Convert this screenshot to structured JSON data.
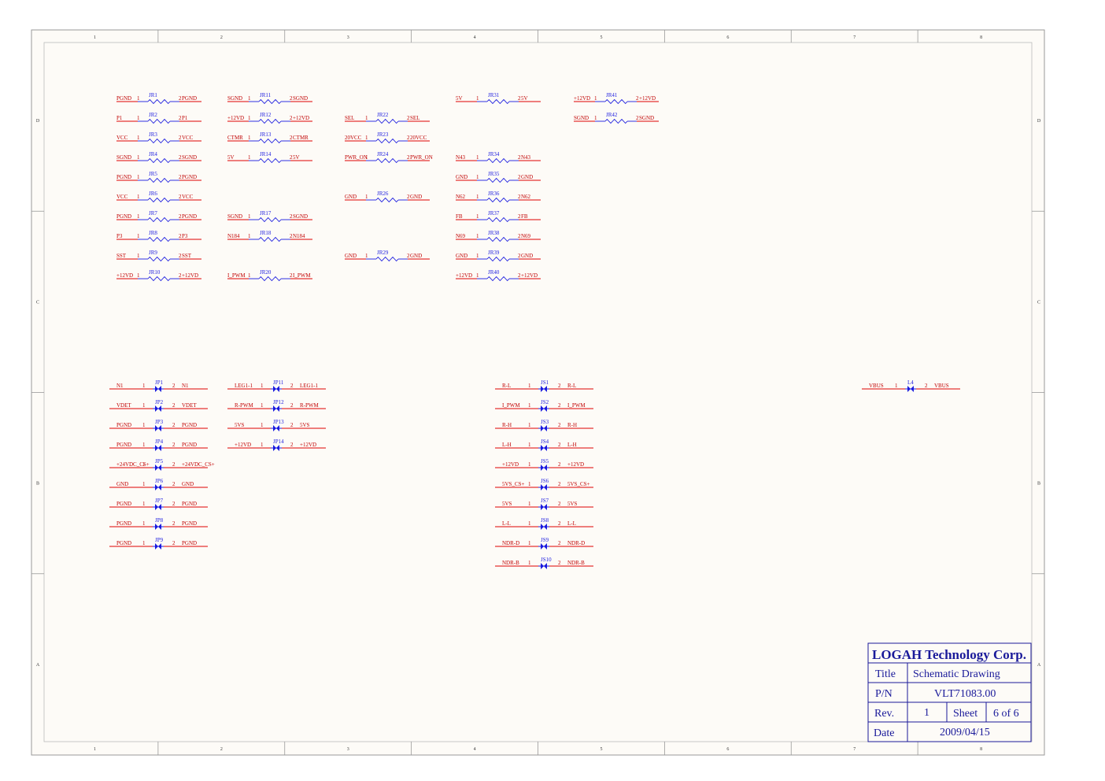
{
  "frame": {
    "columns": [
      "1",
      "2",
      "3",
      "4",
      "5",
      "6",
      "7",
      "8"
    ],
    "rows": [
      "D",
      "C",
      "B",
      "A"
    ]
  },
  "resistors": [
    {
      "ref": "JR1",
      "left": "PGND",
      "right": "PGND",
      "p1": "1",
      "p2": "2"
    },
    {
      "ref": "JR2",
      "left": "P1",
      "right": "P1",
      "p1": "1",
      "p2": "2"
    },
    {
      "ref": "JR3",
      "left": "VCC",
      "right": "VCC",
      "p1": "1",
      "p2": "2"
    },
    {
      "ref": "JR4",
      "left": "SGND",
      "right": "SGND",
      "p1": "1",
      "p2": "2"
    },
    {
      "ref": "JR5",
      "left": "PGND",
      "right": "PGND",
      "p1": "1",
      "p2": "2"
    },
    {
      "ref": "JR6",
      "left": "VCC",
      "right": "VCC",
      "p1": "1",
      "p2": "2"
    },
    {
      "ref": "JR7",
      "left": "PGND",
      "right": "PGND",
      "p1": "1",
      "p2": "2"
    },
    {
      "ref": "JR8",
      "left": "P3",
      "right": "P3",
      "p1": "1",
      "p2": "2"
    },
    {
      "ref": "JR9",
      "left": "SST",
      "right": "SST",
      "p1": "1",
      "p2": "2"
    },
    {
      "ref": "JR10",
      "left": "+12VD",
      "right": "+12VD",
      "p1": "1",
      "p2": "2"
    },
    {
      "ref": "JR11",
      "left": "SGND",
      "right": "SGND",
      "p1": "1",
      "p2": "2"
    },
    {
      "ref": "JR12",
      "left": "+12VD",
      "right": "+12VD",
      "p1": "1",
      "p2": "2"
    },
    {
      "ref": "JR13",
      "left": "CTMR",
      "right": "CTMR",
      "p1": "1",
      "p2": "2"
    },
    {
      "ref": "JR14",
      "left": "5V",
      "right": "5V",
      "p1": "1",
      "p2": "2"
    },
    {
      "ref": "JR17",
      "left": "SGND",
      "right": "SGND",
      "p1": "1",
      "p2": "2"
    },
    {
      "ref": "JR18",
      "left": "N184",
      "right": "N184",
      "p1": "1",
      "p2": "2"
    },
    {
      "ref": "JR20",
      "left": "I_PWM",
      "right": "I_PWM",
      "p1": "1",
      "p2": "2"
    },
    {
      "ref": "JR22",
      "left": "SEL",
      "right": "SEL",
      "p1": "1",
      "p2": "2"
    },
    {
      "ref": "JR23",
      "left": "20VCC",
      "right": "20VCC",
      "p1": "1",
      "p2": "2"
    },
    {
      "ref": "JR24",
      "left": "PWR_ON",
      "right": "PWR_ON",
      "p1": "1",
      "p2": "2"
    },
    {
      "ref": "JR26",
      "left": "GND",
      "right": "GND",
      "p1": "1",
      "p2": "2"
    },
    {
      "ref": "JR29",
      "left": "GND",
      "right": "GND",
      "p1": "1",
      "p2": "2"
    },
    {
      "ref": "JR31",
      "left": "5V",
      "right": "5V",
      "p1": "1",
      "p2": "2"
    },
    {
      "ref": "JR34",
      "left": "N43",
      "right": "N43",
      "p1": "1",
      "p2": "2"
    },
    {
      "ref": "JR35",
      "left": "GND",
      "right": "GND",
      "p1": "1",
      "p2": "2"
    },
    {
      "ref": "JR36",
      "left": "N62",
      "right": "N62",
      "p1": "1",
      "p2": "2"
    },
    {
      "ref": "JR37",
      "left": "FB",
      "right": "FB",
      "p1": "1",
      "p2": "2"
    },
    {
      "ref": "JR38",
      "left": "N69",
      "right": "N69",
      "p1": "1",
      "p2": "2"
    },
    {
      "ref": "JR39",
      "left": "GND",
      "right": "GND",
      "p1": "1",
      "p2": "2"
    },
    {
      "ref": "JR40",
      "left": "+12VD",
      "right": "+12VD",
      "p1": "1",
      "p2": "2"
    },
    {
      "ref": "JR41",
      "left": "+12VD",
      "right": "+12VD",
      "p1": "1",
      "p2": "2"
    },
    {
      "ref": "JR42",
      "left": "SGND",
      "right": "SGND",
      "p1": "1",
      "p2": "2"
    }
  ],
  "jumpers": [
    {
      "ref": "JP1",
      "left": "N1",
      "right": "N1",
      "p1": "1",
      "p2": "2"
    },
    {
      "ref": "JP2",
      "left": "VDET",
      "right": "VDET",
      "p1": "1",
      "p2": "2"
    },
    {
      "ref": "JP3",
      "left": "PGND",
      "right": "PGND",
      "p1": "1",
      "p2": "2"
    },
    {
      "ref": "JP4",
      "left": "PGND",
      "right": "PGND",
      "p1": "1",
      "p2": "2"
    },
    {
      "ref": "JP5",
      "left": "+24VDC_CS+",
      "right": "+24VDC_CS+",
      "p1": "1",
      "p2": "2"
    },
    {
      "ref": "JP6",
      "left": "GND",
      "right": "GND",
      "p1": "1",
      "p2": "2"
    },
    {
      "ref": "JP7",
      "left": "PGND",
      "right": "PGND",
      "p1": "1",
      "p2": "2"
    },
    {
      "ref": "JP8",
      "left": "PGND",
      "right": "PGND",
      "p1": "1",
      "p2": "2"
    },
    {
      "ref": "JP9",
      "left": "PGND",
      "right": "PGND",
      "p1": "1",
      "p2": "2"
    },
    {
      "ref": "JP11",
      "left": "LEG1-1",
      "right": "LEG1-1",
      "p1": "1",
      "p2": "2"
    },
    {
      "ref": "JP12",
      "left": "R-PWM",
      "right": "R-PWM",
      "p1": "1",
      "p2": "2"
    },
    {
      "ref": "JP13",
      "left": "5VS",
      "right": "5VS",
      "p1": "1",
      "p2": "2"
    },
    {
      "ref": "JP14",
      "left": "+12VD",
      "right": "+12VD",
      "p1": "1",
      "p2": "2"
    },
    {
      "ref": "JS1",
      "left": "R-L",
      "right": "R-L",
      "p1": "1",
      "p2": "2"
    },
    {
      "ref": "JS2",
      "left": "I_PWM",
      "right": "I_PWM",
      "p1": "1",
      "p2": "2"
    },
    {
      "ref": "JS3",
      "left": "R-H",
      "right": "R-H",
      "p1": "1",
      "p2": "2"
    },
    {
      "ref": "JS4",
      "left": "L-H",
      "right": "L-H",
      "p1": "1",
      "p2": "2"
    },
    {
      "ref": "JS5",
      "left": "+12VD",
      "right": "+12VD",
      "p1": "1",
      "p2": "2"
    },
    {
      "ref": "JS6",
      "left": "5VS_CS+",
      "right": "5VS_CS+",
      "p1": "1",
      "p2": "2"
    },
    {
      "ref": "JS7",
      "left": "5VS",
      "right": "5VS",
      "p1": "1",
      "p2": "2"
    },
    {
      "ref": "JS8",
      "left": "L-L",
      "right": "L-L",
      "p1": "1",
      "p2": "2"
    },
    {
      "ref": "JS9",
      "left": "NDR-D",
      "right": "NDR-D",
      "p1": "1",
      "p2": "2"
    },
    {
      "ref": "JS10",
      "left": "NDR-B",
      "right": "NDR-B",
      "p1": "1",
      "p2": "2"
    },
    {
      "ref": "L4",
      "left": "VBUS",
      "right": "VBUS",
      "p1": "1",
      "p2": "2"
    }
  ],
  "title_block": {
    "company": "LOGAH Technology Corp.",
    "title_label": "Title",
    "title_value": "Schematic Drawing",
    "pn_label": "P/N",
    "pn_value": "VLT71083.00",
    "rev_label": "Rev.",
    "rev_value": "1",
    "sheet_label": "Sheet",
    "sheet_value": "6 of 6",
    "date_label": "Date",
    "date_value": "2009/04/15"
  },
  "colors": {
    "background": "#fdfbf7",
    "wire": "#e00000",
    "net_label": "#c00000",
    "component": "#1a1adf",
    "frame": "#999999"
  }
}
